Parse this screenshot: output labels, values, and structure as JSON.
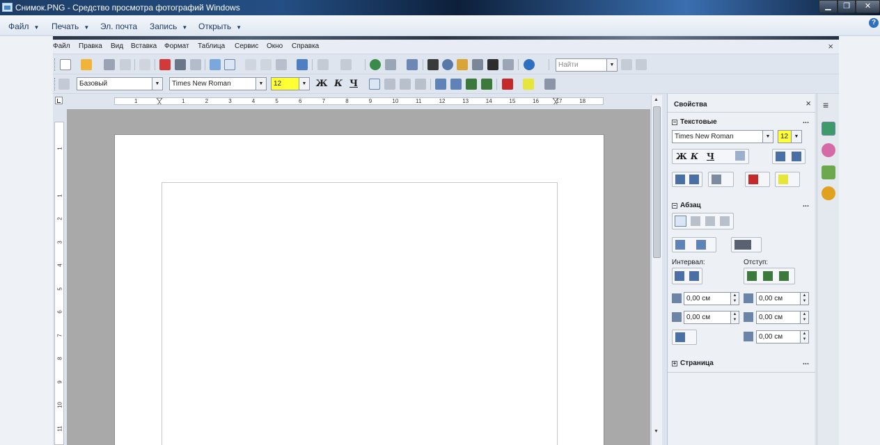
{
  "window": {
    "title": "Снимок.PNG - Средство просмотра фотографий Windows"
  },
  "viewer_menu": {
    "items": [
      "Файл",
      "Печать",
      "Эл. почта",
      "Запись",
      "Открыть"
    ]
  },
  "writer_menu": {
    "items": [
      "Файл",
      "Правка",
      "Вид",
      "Вставка",
      "Формат",
      "Таблица",
      "Сервис",
      "Окно",
      "Справка"
    ],
    "close": "×"
  },
  "toolbar": {
    "find_placeholder": "Найти",
    "paragraph_style": "Базовый",
    "font_name": "Times New Roman",
    "font_size": "12",
    "bold": "Ж",
    "italic": "К",
    "underline": "Ч"
  },
  "ruler": {
    "numbers": [
      "1",
      "1",
      "2",
      "3",
      "4",
      "5",
      "6",
      "7",
      "8",
      "9",
      "10",
      "11",
      "12",
      "13",
      "14",
      "15",
      "16",
      "17",
      "18"
    ],
    "vertical_numbers": [
      "1",
      "1",
      "2",
      "3",
      "4",
      "5",
      "6",
      "7",
      "8",
      "9",
      "10",
      "11"
    ]
  },
  "sidebar": {
    "title": "Свойства",
    "close": "×",
    "text_section": "Текстовые",
    "font_name": "Times New Roman",
    "font_size": "12",
    "paragraph_section": "Абзац",
    "interval_label": "Интервал:",
    "indent_label": "Отступ:",
    "spacing_above": "0,00 см",
    "spacing_below": "0,00 см",
    "indent_before": "0,00 см",
    "indent_after": "0,00 см",
    "indent_first": "0,00 см",
    "page_section": "Страница",
    "more": "..."
  },
  "colors": {
    "highlight": "#ffff33",
    "titlebar": "#244f84"
  }
}
